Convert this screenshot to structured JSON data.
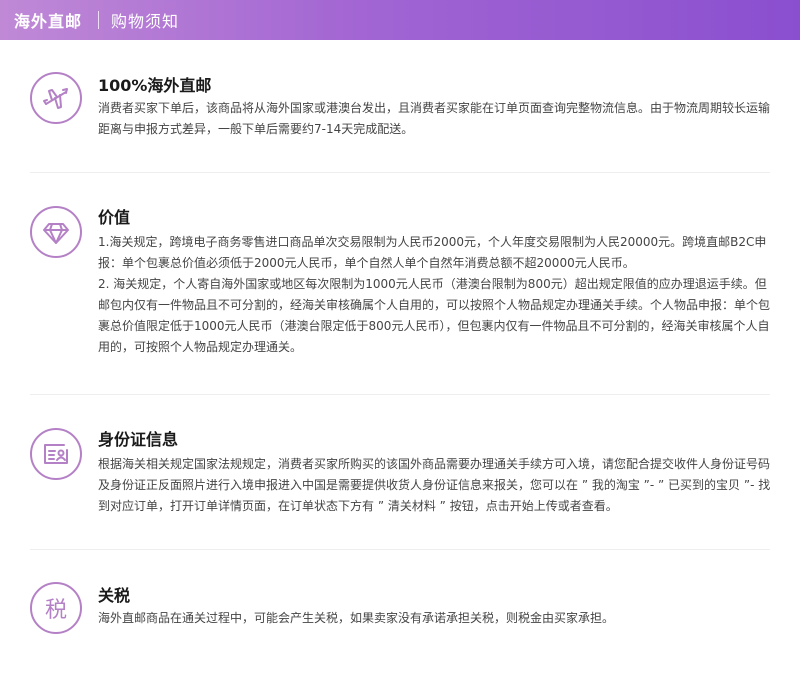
{
  "header": {
    "title": "海外直邮",
    "subtitle": "购物须知"
  },
  "sections": [
    {
      "icon": "airplane-icon",
      "title": "100%海外直邮",
      "paragraphs": [
        "消费者买家下单后，该商品将从海外国家或港澳台发出，且消费者买家能在订单页面查询完整物流信息。由于物流周期较长运输距离与申报方式差异，一般下单后需要约7-14天完成配送。"
      ]
    },
    {
      "icon": "diamond-icon",
      "title": "价值",
      "paragraphs": [
        "1.海关规定，跨境电子商务零售进口商品单次交易限制为人民币2000元，个人年度交易限制为人民20000元。跨境直邮B2C申报：单个包裹总价值必须低于2000元人民币，单个自然人单个自然年消费总额不超20000元人民币。",
        "2. 海关规定，个人寄自海外国家或地区每次限制为1000元人民币（港澳台限制为800元）超出规定限值的应办理退运手续。但邮包内仅有一件物品且不可分割的，经海关审核确属个人自用的，可以按照个人物品规定办理通关手续。个人物品申报：单个包裹总价值限定低于1000元人民币（港澳台限定低于800元人民币），但包裹内仅有一件物品且不可分割的，经海关审核属个人自用的，可按照个人物品规定办理通关。"
      ]
    },
    {
      "icon": "id-card-icon",
      "title": "身份证信息",
      "paragraphs": [
        "根据海关相关规定国家法规规定，消费者买家所购买的该国外商品需要办理通关手续方可入境，请您配合提交收件人身份证号码及身份证正反面照片进行入境申报进入中国是需要提供收货人身份证信息来报关，您可以在 ” 我的淘宝 ”- ” 已买到的宝贝 ”- 找到对应订单，打开订单详情页面，在订单状态下方有 ” 清关材料 ” 按钮，点击开始上传或者查看。"
      ]
    },
    {
      "icon": "tax-icon",
      "icon_char": "税",
      "title": "关税",
      "paragraphs": [
        "海外直邮商品在通关过程中，可能会产生关税，如果卖家没有承诺承担关税，则税金由买家承担。"
      ]
    }
  ],
  "colors": {
    "header_start": "#c089d6",
    "header_end": "#8a4fcf",
    "icon": "#b581c6"
  }
}
